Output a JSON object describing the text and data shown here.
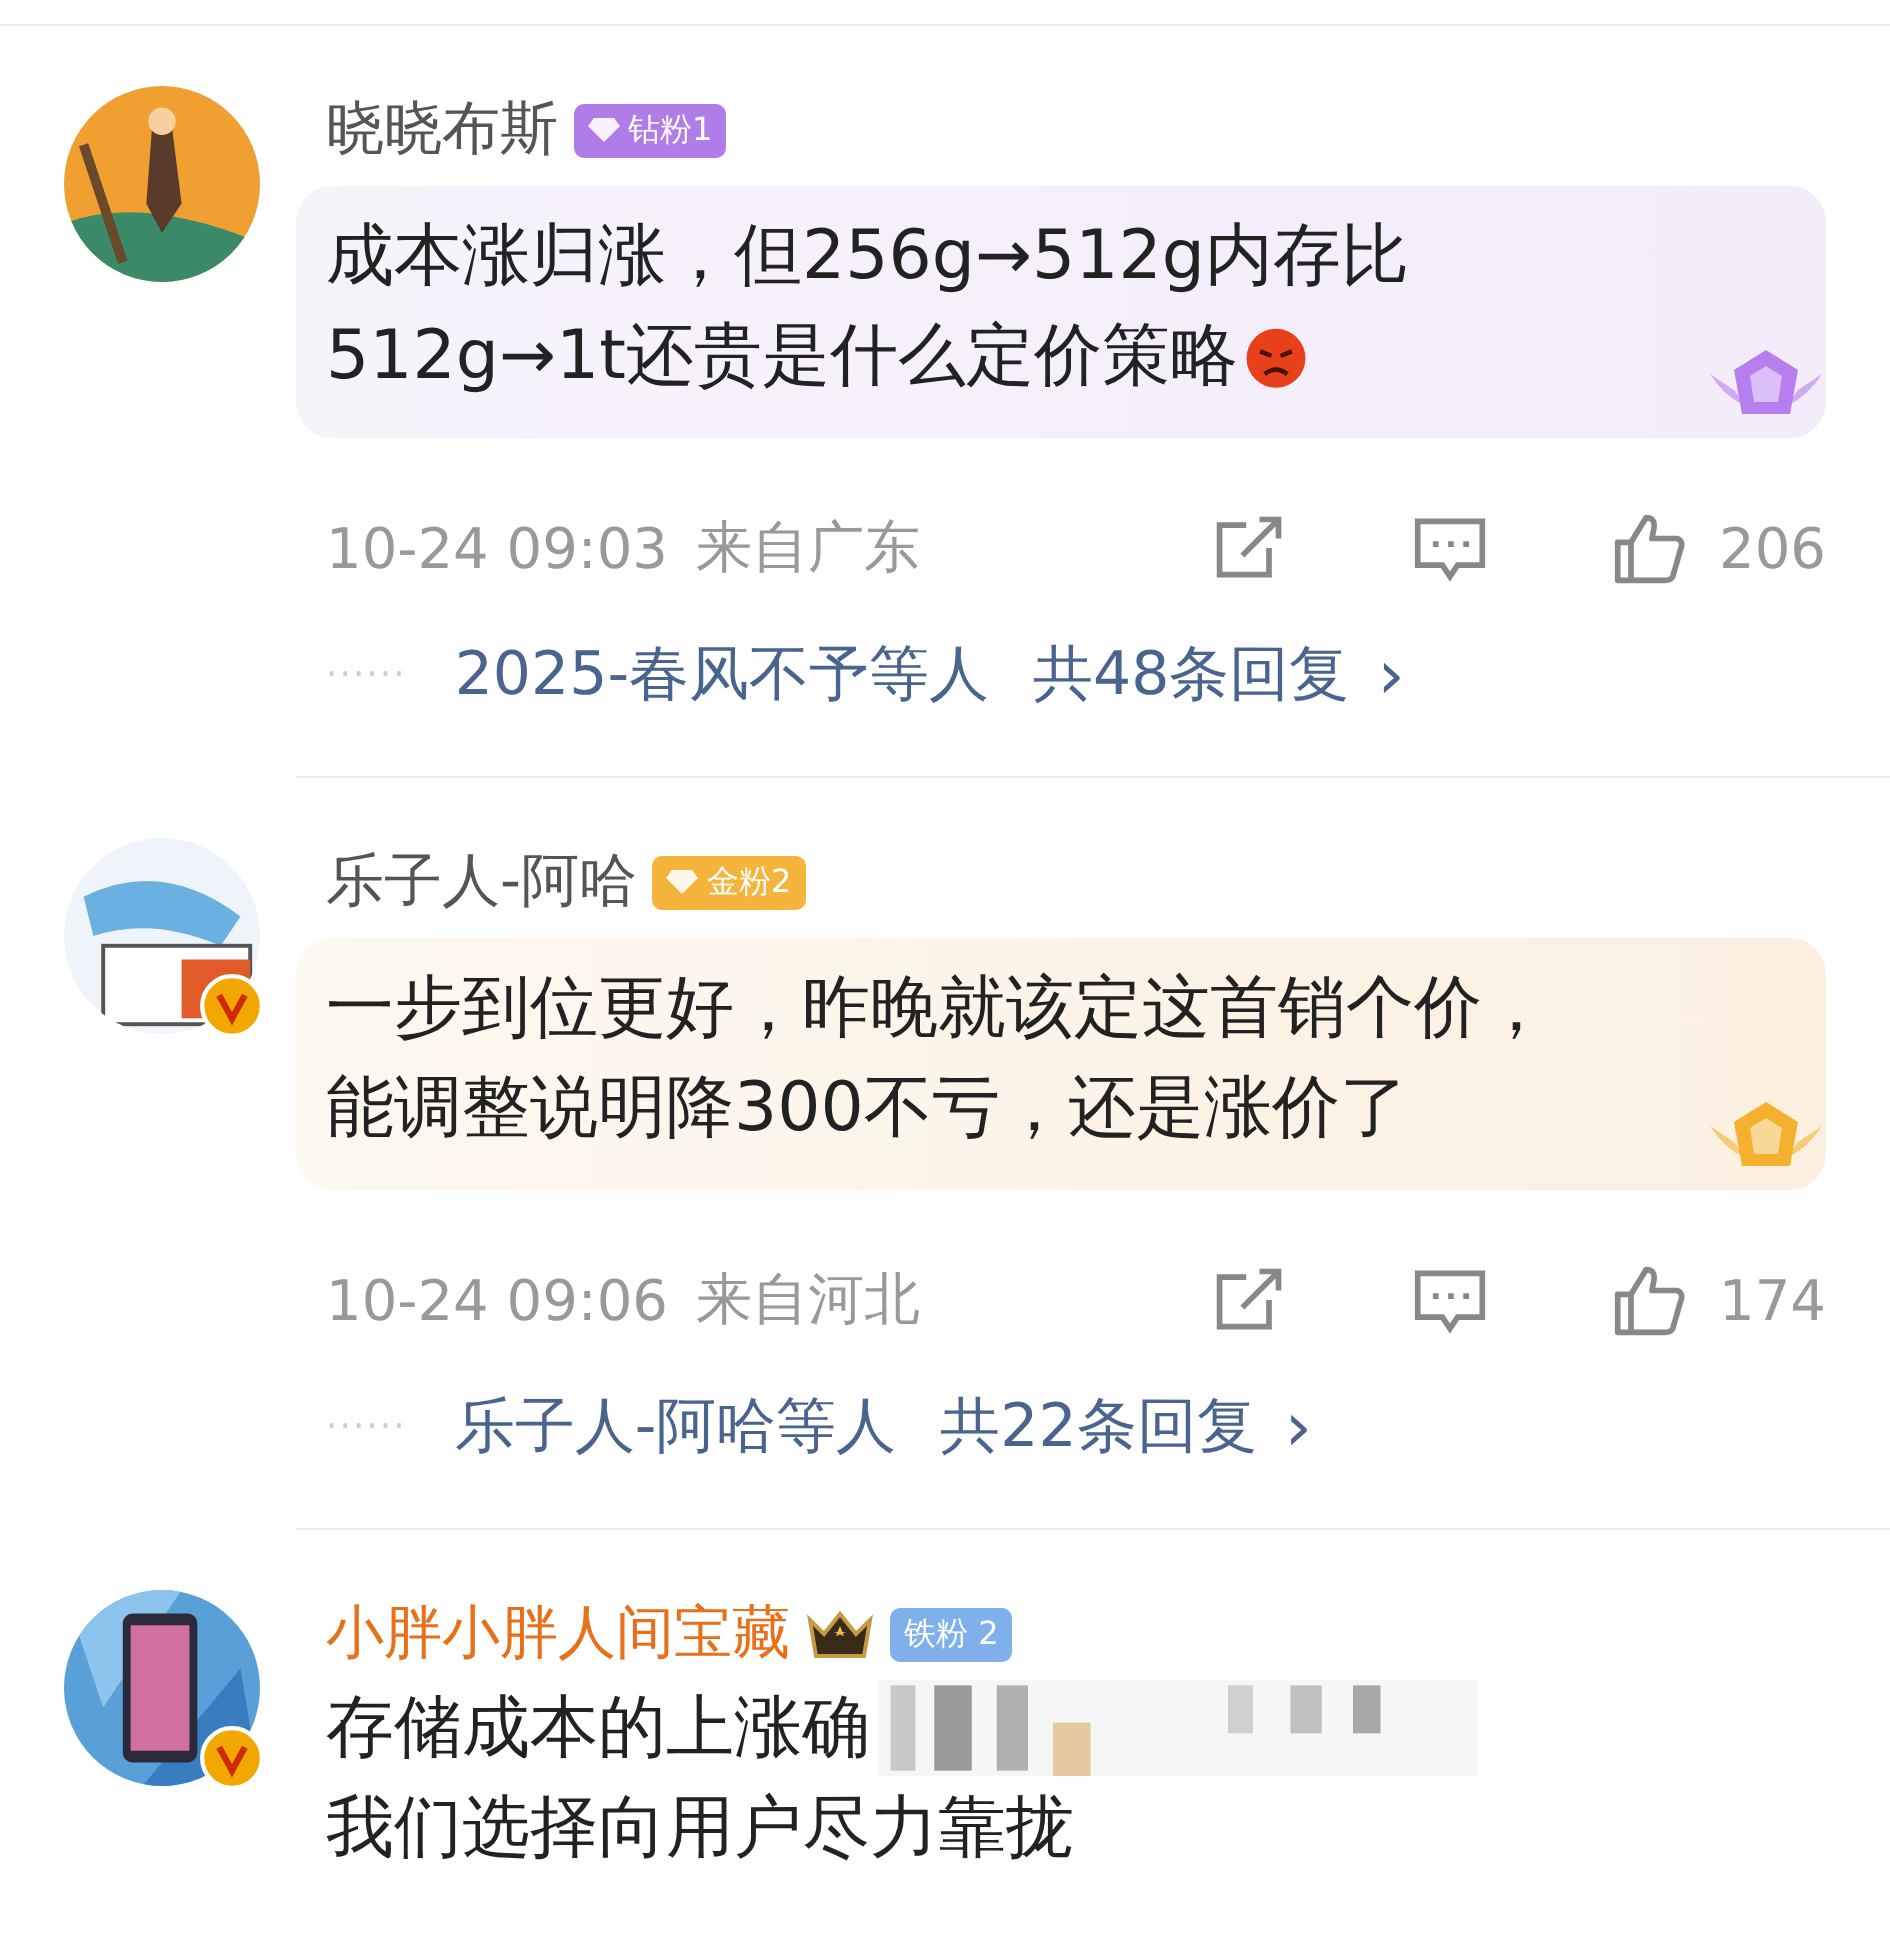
{
  "comments": [
    {
      "user": "晓晓布斯",
      "vip_name": false,
      "verified": false,
      "badge": {
        "kind": "diamond",
        "label": "钻粉1"
      },
      "body": [
        "成本涨归涨，但256g→512g内存比",
        "512g→1t还贵是什么定价策略"
      ],
      "emoji": true,
      "time": "10-24 09:03",
      "location": "来自广东",
      "likes": "206",
      "replies": {
        "dots": "······",
        "who": "2025-春风不予等人",
        "count": "共48条回复",
        "arrow": "›"
      }
    },
    {
      "user": "乐子人-阿哈",
      "vip_name": false,
      "verified": true,
      "badge": {
        "kind": "gold",
        "label": "金粉2"
      },
      "body": [
        "一步到位更好，昨晚就该定这首销个价，",
        "能调整说明降300不亏，还是涨价了"
      ],
      "time": "10-24 09:06",
      "location": "来自河北",
      "likes": "174",
      "replies": {
        "dots": "······",
        "who": "乐子人-阿哈等人",
        "count": "共22条回复",
        "arrow": "›"
      }
    },
    {
      "user": "小胖小胖人间宝藏",
      "vip_name": true,
      "verified": true,
      "badge": {
        "kind": "iron",
        "label": "铁粉 2"
      },
      "body": [
        "存储成本的上涨确",
        "我们选择向用户尽力靠拢"
      ],
      "blurred": true
    }
  ]
}
